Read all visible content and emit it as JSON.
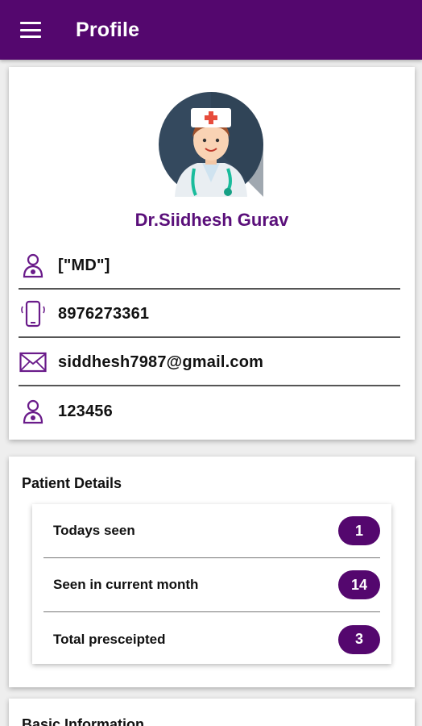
{
  "appbar": {
    "title": "Profile",
    "menu_icon": "hamburger-menu-icon",
    "color": "#54076e"
  },
  "profile": {
    "avatar_icon": "doctor-avatar-icon",
    "name": "Dr.Siidhesh Gurav",
    "rows": [
      {
        "icon": "doctor-icon",
        "value": "[\"MD\"]"
      },
      {
        "icon": "phone-icon",
        "value": "8976273361"
      },
      {
        "icon": "mail-icon",
        "value": "siddhesh7987@gmail.com"
      },
      {
        "icon": "doctor-icon",
        "value": "123456"
      }
    ]
  },
  "patient_details": {
    "title": "Patient Details",
    "stats": [
      {
        "label": "Todays seen",
        "value": "1"
      },
      {
        "label": "Seen in current month",
        "value": "14"
      },
      {
        "label": "Total presceipted",
        "value": "3"
      }
    ]
  },
  "basic_information": {
    "title": "Basic Information"
  }
}
